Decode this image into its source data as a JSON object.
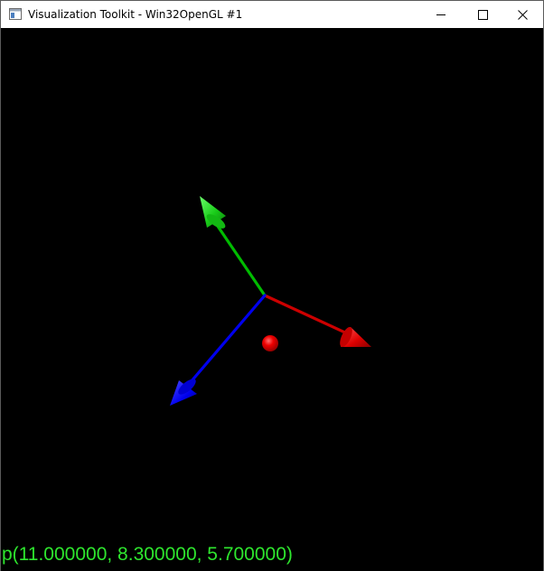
{
  "window": {
    "title": "Visualization Toolkit - Win32OpenGL #1",
    "icon": "vtk-window-icon",
    "controls": {
      "minimize": "minimize-icon",
      "maximize": "maximize-icon",
      "close": "close-icon"
    }
  },
  "viewport": {
    "background": "#000000",
    "axes": {
      "x_color": "#cc0000",
      "y_color": "#00bb00",
      "z_color": "#0000ee"
    },
    "point_marker_color": "#ff0000",
    "readout_text": "p(11.000000, 8.300000, 5.700000)",
    "readout_color": "#2ee62e"
  }
}
